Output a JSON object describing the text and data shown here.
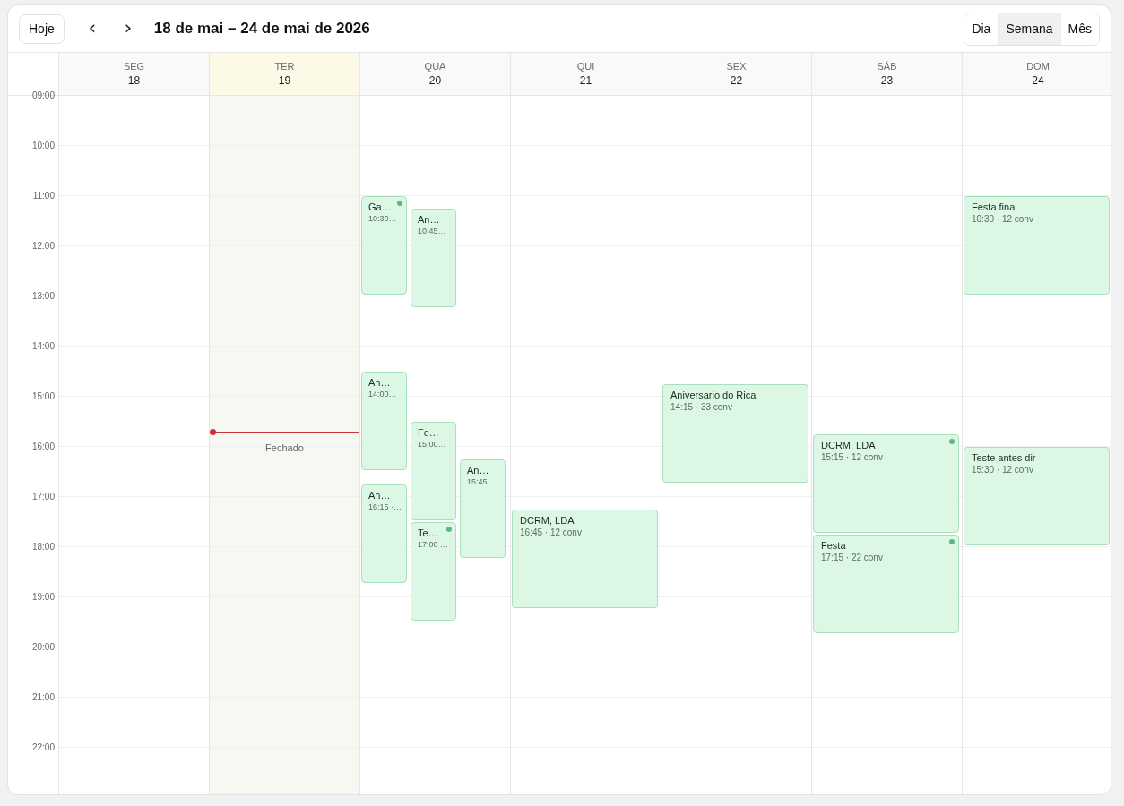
{
  "toolbar": {
    "today_button": "Hoje",
    "prev_button": "‹",
    "next_button": "›",
    "title": "18 de mai – 24 de mai de 2026"
  },
  "views": [
    {
      "label": "Dia",
      "selected": false
    },
    {
      "label": "Semana",
      "selected": true
    },
    {
      "label": "Mês",
      "selected": false
    }
  ],
  "hours": [
    "09:00",
    "10:00",
    "11:00",
    "12:00",
    "13:00",
    "14:00",
    "15:00",
    "16:00",
    "17:00",
    "18:00",
    "19:00",
    "20:00",
    "21:00",
    "22:00"
  ],
  "days": [
    {
      "weekday": "SEG",
      "date": "18",
      "today": false,
      "closed": false
    },
    {
      "weekday": "TER",
      "date": "19",
      "today": true,
      "closed": true,
      "closed_label": "Fechado",
      "current_time_line": true
    },
    {
      "weekday": "QUA",
      "date": "20",
      "today": false,
      "closed": false,
      "events": [
        {
          "title": "Ga…",
          "time": "10:30…",
          "flagged": true
        },
        {
          "title": "An…",
          "time": "10:45…",
          "flagged": false
        },
        {
          "title": "An…",
          "time": "14:00…",
          "flagged": false
        },
        {
          "title": "Fe…",
          "time": "15:00…",
          "flagged": false
        },
        {
          "title": "An…",
          "time": "15:45 …",
          "flagged": false
        },
        {
          "title": "An…",
          "time": "16:15 ·…",
          "flagged": false
        },
        {
          "title": "Te…",
          "time": "17:00 …",
          "flagged": true
        }
      ]
    },
    {
      "weekday": "QUI",
      "date": "21",
      "today": false,
      "closed": false,
      "events": [
        {
          "title": "DCRM, LDA",
          "time": "16:45 · 12 conv",
          "flagged": false
        }
      ]
    },
    {
      "weekday": "SEX",
      "date": "22",
      "today": false,
      "closed": false,
      "events": [
        {
          "title": "Aniversario do Rica",
          "time": "14:15 · 33 conv",
          "flagged": false
        }
      ]
    },
    {
      "weekday": "SÁB",
      "date": "23",
      "today": false,
      "closed": false,
      "events": [
        {
          "title": "DCRM, LDA",
          "time": "15:15 · 12 conv",
          "flagged": true
        },
        {
          "title": "Festa",
          "time": "17:15 · 22 conv",
          "flagged": true
        }
      ]
    },
    {
      "weekday": "DOM",
      "date": "24",
      "today": false,
      "closed": false,
      "events": [
        {
          "title": "Festa final",
          "time": "10:30 · 12 conv",
          "flagged": false
        },
        {
          "title": "Teste antes dir",
          "time": "15:30 · 12 conv",
          "flagged": false
        }
      ]
    }
  ]
}
